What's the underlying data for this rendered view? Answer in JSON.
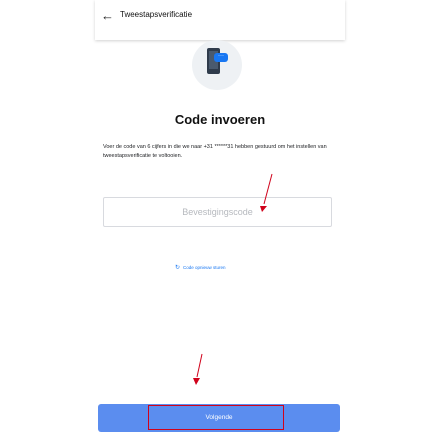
{
  "header": {
    "title": "Tweestapsverificatie"
  },
  "main": {
    "title": "Code invoeren",
    "description": "Voer de code van 6 cijfers in die we naar +31 ******31 hebben gestuurd om het instellen van tweestapsverificatie te voltooien.",
    "code_placeholder": "Bevestigingscode",
    "resend_label": "Code opnieuw sturen"
  },
  "footer": {
    "next_label": "Volgende"
  },
  "colors": {
    "accent": "#1877f2",
    "button": "#5b8def",
    "annotation": "#d0021b"
  }
}
